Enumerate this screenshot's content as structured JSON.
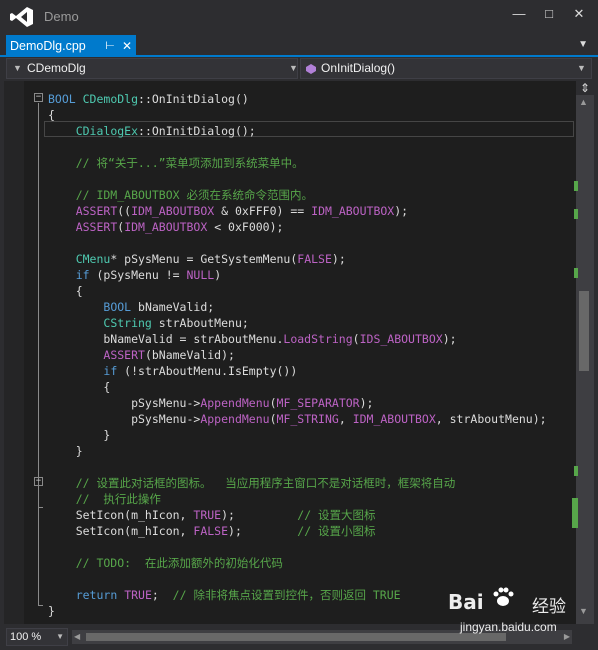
{
  "window": {
    "title": "Demo"
  },
  "tabs": [
    {
      "label": "DemoDlg.cpp",
      "active": true
    }
  ],
  "navbar": {
    "class_combo": "CDemoDlg",
    "member_combo": "OnInitDialog()"
  },
  "editor": {
    "lines": [
      [
        [
          "BOOL ",
          "kw"
        ],
        [
          "CDemoDlg",
          "ty"
        ],
        [
          "::OnInitDialog()",
          "fn"
        ]
      ],
      [
        [
          "{",
          "fn"
        ]
      ],
      [
        [
          "    ",
          "fn"
        ],
        [
          "CDialogEx",
          "ty"
        ],
        [
          "::OnInitDialog();",
          "fn"
        ]
      ],
      [],
      [
        [
          "    // 将“关于...”菜单项添加到系统菜单中。",
          "cm"
        ]
      ],
      [],
      [
        [
          "    // IDM_ABOUTBOX 必须在系统命令范围内。",
          "cm"
        ]
      ],
      [
        [
          "    ",
          "fn"
        ],
        [
          "ASSERT",
          "mc"
        ],
        [
          "((",
          "fn"
        ],
        [
          "IDM_ABOUTBOX",
          "mc"
        ],
        [
          " & 0xFFF0) == ",
          "fn"
        ],
        [
          "IDM_ABOUTBOX",
          "mc"
        ],
        [
          ");",
          "fn"
        ]
      ],
      [
        [
          "    ",
          "fn"
        ],
        [
          "ASSERT",
          "mc"
        ],
        [
          "(",
          "fn"
        ],
        [
          "IDM_ABOUTBOX",
          "mc"
        ],
        [
          " < 0xF000);",
          "fn"
        ]
      ],
      [],
      [
        [
          "    ",
          "fn"
        ],
        [
          "CMenu",
          "ty"
        ],
        [
          "* pSysMenu = GetSystemMenu(",
          "fn"
        ],
        [
          "FALSE",
          "mc"
        ],
        [
          ");",
          "fn"
        ]
      ],
      [
        [
          "    ",
          "fn"
        ],
        [
          "if",
          "kw"
        ],
        [
          " (pSysMenu != ",
          "fn"
        ],
        [
          "NULL",
          "mc"
        ],
        [
          ")",
          "fn"
        ]
      ],
      [
        [
          "    {",
          "fn"
        ]
      ],
      [
        [
          "        ",
          "fn"
        ],
        [
          "BOOL",
          "kw"
        ],
        [
          " bNameValid;",
          "fn"
        ]
      ],
      [
        [
          "        ",
          "fn"
        ],
        [
          "CString",
          "ty"
        ],
        [
          " strAboutMenu;",
          "fn"
        ]
      ],
      [
        [
          "        bNameValid = strAboutMenu.",
          "fn"
        ],
        [
          "LoadString",
          "mc"
        ],
        [
          "(",
          "fn"
        ],
        [
          "IDS_ABOUTBOX",
          "mc"
        ],
        [
          ");",
          "fn"
        ]
      ],
      [
        [
          "        ",
          "fn"
        ],
        [
          "ASSERT",
          "mc"
        ],
        [
          "(bNameValid);",
          "fn"
        ]
      ],
      [
        [
          "        ",
          "fn"
        ],
        [
          "if",
          "kw"
        ],
        [
          " (!strAboutMenu.IsEmpty())",
          "fn"
        ]
      ],
      [
        [
          "        {",
          "fn"
        ]
      ],
      [
        [
          "            pSysMenu->",
          "fn"
        ],
        [
          "AppendMenu",
          "mc"
        ],
        [
          "(",
          "fn"
        ],
        [
          "MF_SEPARATOR",
          "mc"
        ],
        [
          ");",
          "fn"
        ]
      ],
      [
        [
          "            pSysMenu->",
          "fn"
        ],
        [
          "AppendMenu",
          "mc"
        ],
        [
          "(",
          "fn"
        ],
        [
          "MF_STRING",
          "mc"
        ],
        [
          ", ",
          "fn"
        ],
        [
          "IDM_ABOUTBOX",
          "mc"
        ],
        [
          ", strAboutMenu);",
          "fn"
        ]
      ],
      [
        [
          "        }",
          "fn"
        ]
      ],
      [
        [
          "    }",
          "fn"
        ]
      ],
      [],
      [
        [
          "    // 设置此对话框的图标。  当应用程序主窗口不是对话框时，框架将自动",
          "cm"
        ]
      ],
      [
        [
          "    //  执行此操作",
          "cm"
        ]
      ],
      [
        [
          "    SetIcon(m_hIcon, ",
          "fn"
        ],
        [
          "TRUE",
          "mc"
        ],
        [
          ");         ",
          "fn"
        ],
        [
          "// 设置大图标",
          "cm"
        ]
      ],
      [
        [
          "    SetIcon(m_hIcon, ",
          "fn"
        ],
        [
          "FALSE",
          "mc"
        ],
        [
          ");        ",
          "fn"
        ],
        [
          "// 设置小图标",
          "cm"
        ]
      ],
      [],
      [
        [
          "    // TODO:  在此添加额外的初始化代码",
          "cm"
        ]
      ],
      [],
      [
        [
          "    ",
          "fn"
        ],
        [
          "return",
          "kw"
        ],
        [
          " ",
          "fn"
        ],
        [
          "TRUE",
          "mc"
        ],
        [
          ";  ",
          "fn"
        ],
        [
          "// 除非将焦点设置到控件，否则返回 TRUE",
          "cm"
        ]
      ],
      [
        [
          "}",
          "fn"
        ]
      ]
    ]
  },
  "statusbar": {
    "zoom": "100 %"
  },
  "watermark": {
    "brand": "Bai",
    "brand_suffix": "经验",
    "url": "jingyan.baidu.com"
  }
}
